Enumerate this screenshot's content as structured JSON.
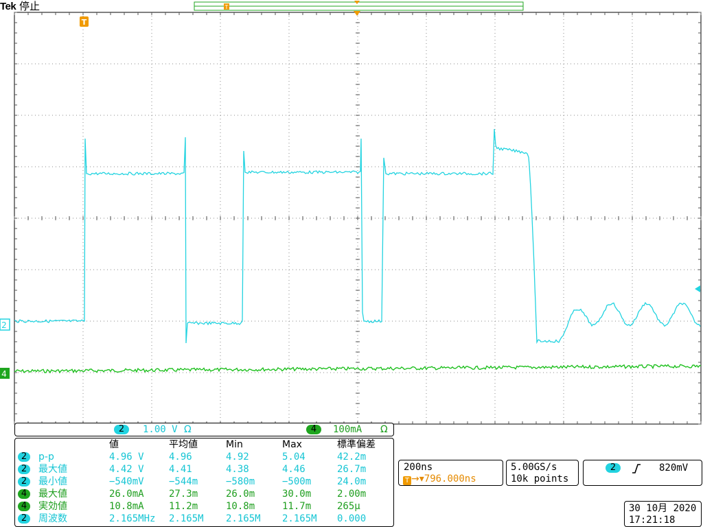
{
  "brand": "Tek",
  "status": "停止",
  "channel_settings": {
    "ch2": {
      "number": "2",
      "scale": "1.00 V",
      "coupling": "Ω"
    },
    "ch4": {
      "number": "4",
      "scale": "100mA",
      "coupling": "Ω"
    }
  },
  "markers": {
    "trigger_tag": "T",
    "ch2_ground": "2",
    "ch4_ground": "4"
  },
  "measurements": {
    "headers": [
      "値",
      "平均値",
      "Min",
      "Max",
      "標準偏差"
    ],
    "rows": [
      {
        "ch": "2",
        "label": "p-p",
        "value": "4.96 V",
        "mean": "4.96",
        "min": "4.92",
        "max": "5.04",
        "std": "42.2m",
        "color": "cyan"
      },
      {
        "ch": "2",
        "label": "最大値",
        "value": "4.42 V",
        "mean": "4.41",
        "min": "4.38",
        "max": "4.46",
        "std": "26.7m",
        "color": "cyan"
      },
      {
        "ch": "2",
        "label": "最小値",
        "value": "−540mV",
        "mean": "−544m",
        "min": "−580m",
        "max": "−500m",
        "std": "24.0m",
        "color": "cyan"
      },
      {
        "ch": "4",
        "label": "最大値",
        "value": "26.0mA",
        "mean": "27.3m",
        "min": "26.0m",
        "max": "30.0m",
        "std": "2.00m",
        "color": "green"
      },
      {
        "ch": "4",
        "label": "実効値",
        "value": "10.8mA",
        "mean": "11.2m",
        "min": "10.8m",
        "max": "11.7m",
        "std": "265µ",
        "color": "green"
      },
      {
        "ch": "2",
        "label": "周波数",
        "value": "2.165MHz",
        "mean": "2.165M",
        "min": "2.165M",
        "max": "2.165M",
        "std": "0.000",
        "color": "cyan"
      }
    ]
  },
  "timebase": {
    "scale": "200ns",
    "position": "796.000ns",
    "position_icon": "T"
  },
  "acquisition": {
    "rate": "5.00GS/s",
    "points": "10k points"
  },
  "trigger": {
    "channel": "2",
    "slope_icon": "rising-edge",
    "level": "820mV"
  },
  "datetime": {
    "date": "30 10月 2020",
    "time": "17:21:18"
  },
  "colors": {
    "ch2": "#22d3e0",
    "ch4": "#1fb51f",
    "trigger": "#f09a00",
    "grid": "#5a5a5a"
  },
  "waveform_description_ch2": "square pulse train between low (~-0.5 V) and high (~4.4 V) levels, followed by a decaying step and ringing",
  "waveform_description_ch4": "flat slightly noisy trace near zero current"
}
